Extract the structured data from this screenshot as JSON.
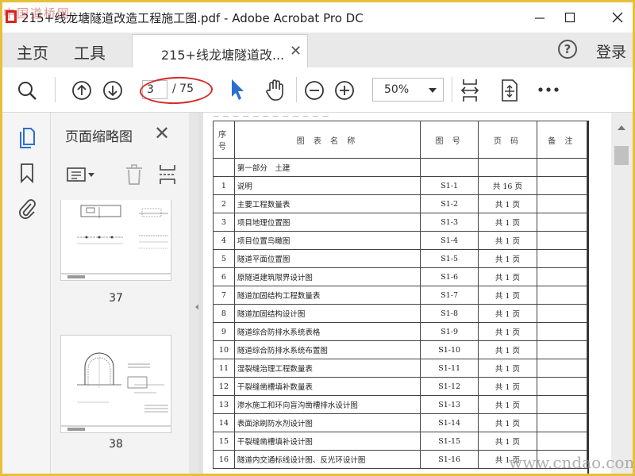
{
  "window": {
    "title": "215+线龙塘隧道改造工程施工图.pdf - Adobe Acrobat Pro DC",
    "watermark_top": "中国道桥网"
  },
  "tabs": {
    "home": "主页",
    "tools": "工具",
    "document": "215+线龙塘隧道改...",
    "login": "登录"
  },
  "toolbar": {
    "page_current": "3",
    "page_total": "/ 75",
    "zoom": "50%",
    "icons": [
      "search-icon",
      "page-up-icon",
      "page-down-icon",
      "select-pointer-icon",
      "hand-tool-icon",
      "zoom-out-icon",
      "zoom-in-icon",
      "fit-width-icon",
      "fit-page-icon",
      "more-icon"
    ]
  },
  "sidebar": {
    "title": "页面缩略图",
    "thumbnails": [
      {
        "page": "37"
      },
      {
        "page": "38"
      }
    ]
  },
  "document": {
    "columns": [
      "序号",
      "图 表 名 称",
      "图 号",
      "页 码",
      "备 注"
    ],
    "section": "第一部分　土建",
    "rows": [
      {
        "no": "1",
        "name": "说明",
        "code": "S1-1",
        "pages": "共 16 页"
      },
      {
        "no": "2",
        "name": "主要工程数量表",
        "code": "S1-2",
        "pages": "共 1 页"
      },
      {
        "no": "3",
        "name": "项目地理位置图",
        "code": "S1-3",
        "pages": "共 1 页"
      },
      {
        "no": "4",
        "name": "项目位置鸟瞰图",
        "code": "S1-4",
        "pages": "共 1 页"
      },
      {
        "no": "5",
        "name": "隧道平面位置图",
        "code": "S1-5",
        "pages": "共 1 页"
      },
      {
        "no": "6",
        "name": "原隧道建筑限界设计图",
        "code": "S1-6",
        "pages": "共 1 页"
      },
      {
        "no": "7",
        "name": "隧道加固结构工程数量表",
        "code": "S1-7",
        "pages": "共 1 页"
      },
      {
        "no": "8",
        "name": "隧道加固结构设计图",
        "code": "S1-8",
        "pages": "共 1 页"
      },
      {
        "no": "9",
        "name": "隧道综合防排水系统表格",
        "code": "S1-9",
        "pages": "共 1 页"
      },
      {
        "no": "10",
        "name": "隧道综合防排水系统布置图",
        "code": "S1-10",
        "pages": "共 1 页"
      },
      {
        "no": "11",
        "name": "湿裂缝治理工程数量表",
        "code": "S1-11",
        "pages": "共 1 页"
      },
      {
        "no": "12",
        "name": "干裂缝凿槽填补数量表",
        "code": "S1-12",
        "pages": "共 1 页"
      },
      {
        "no": "13",
        "name": "渗水施工和环向盲沟凿槽排水设计图",
        "code": "S1-13",
        "pages": "共 1 页"
      },
      {
        "no": "14",
        "name": "表面涂刷防水剂设计图",
        "code": "S1-14",
        "pages": "共 1 页"
      },
      {
        "no": "15",
        "name": "干裂缝凿槽填补设计图",
        "code": "S1-15",
        "pages": "共 1 页"
      },
      {
        "no": "16",
        "name": "隧道内交通标线设计图、反光环设计图",
        "code": "S1-16",
        "pages": "共 1 页"
      }
    ]
  },
  "watermark_bottom": "www.cndao.com",
  "colors": {
    "frame": "#e7c03b",
    "accent": "#2d6fd1",
    "annotation": "#d32a2a"
  }
}
